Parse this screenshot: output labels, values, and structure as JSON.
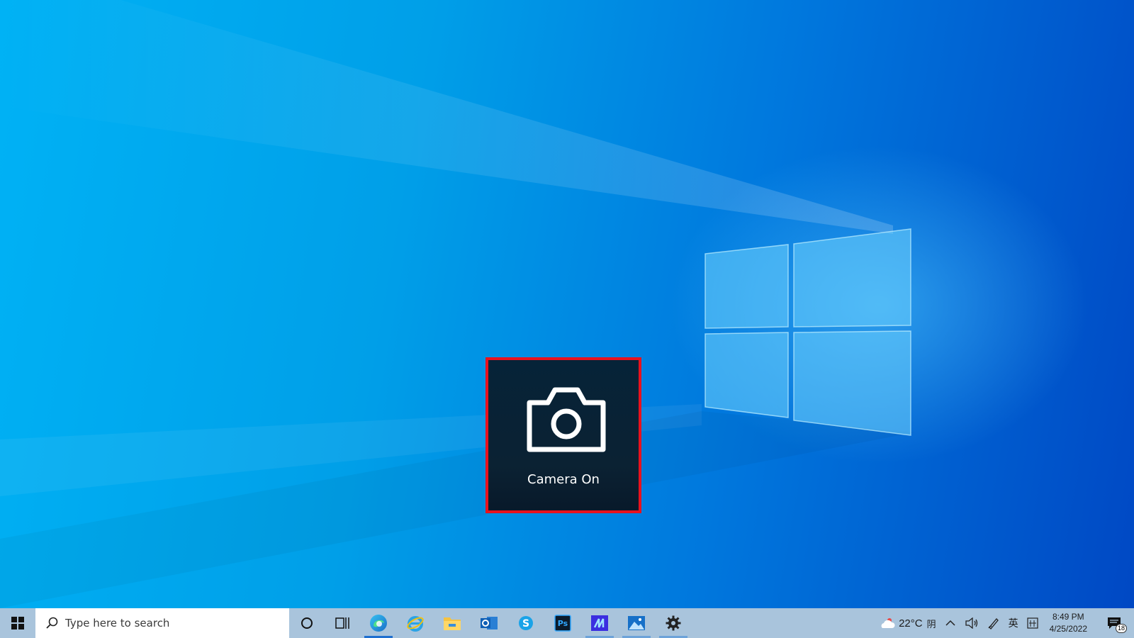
{
  "osd": {
    "label": "Camera On",
    "icon": "camera-icon",
    "border_color": "#e8121e"
  },
  "taskbar": {
    "search_placeholder": "Type here to search",
    "apps": [
      {
        "name": "cortana-icon"
      },
      {
        "name": "task-view-icon"
      },
      {
        "name": "edge-icon",
        "state": "active"
      },
      {
        "name": "internet-explorer-icon"
      },
      {
        "name": "file-explorer-icon"
      },
      {
        "name": "outlook-icon"
      },
      {
        "name": "skype-icon"
      },
      {
        "name": "photoshop-icon",
        "label": "Ps"
      },
      {
        "name": "app-icon",
        "state": "running"
      },
      {
        "name": "photos-icon",
        "state": "running"
      },
      {
        "name": "settings-icon",
        "state": "running"
      }
    ]
  },
  "tray": {
    "weather_temp": "22°C",
    "weather_condition": "阴",
    "ime_language": "英",
    "clock_time": "8:49 PM",
    "clock_date": "4/25/2022",
    "notification_count": "18"
  }
}
